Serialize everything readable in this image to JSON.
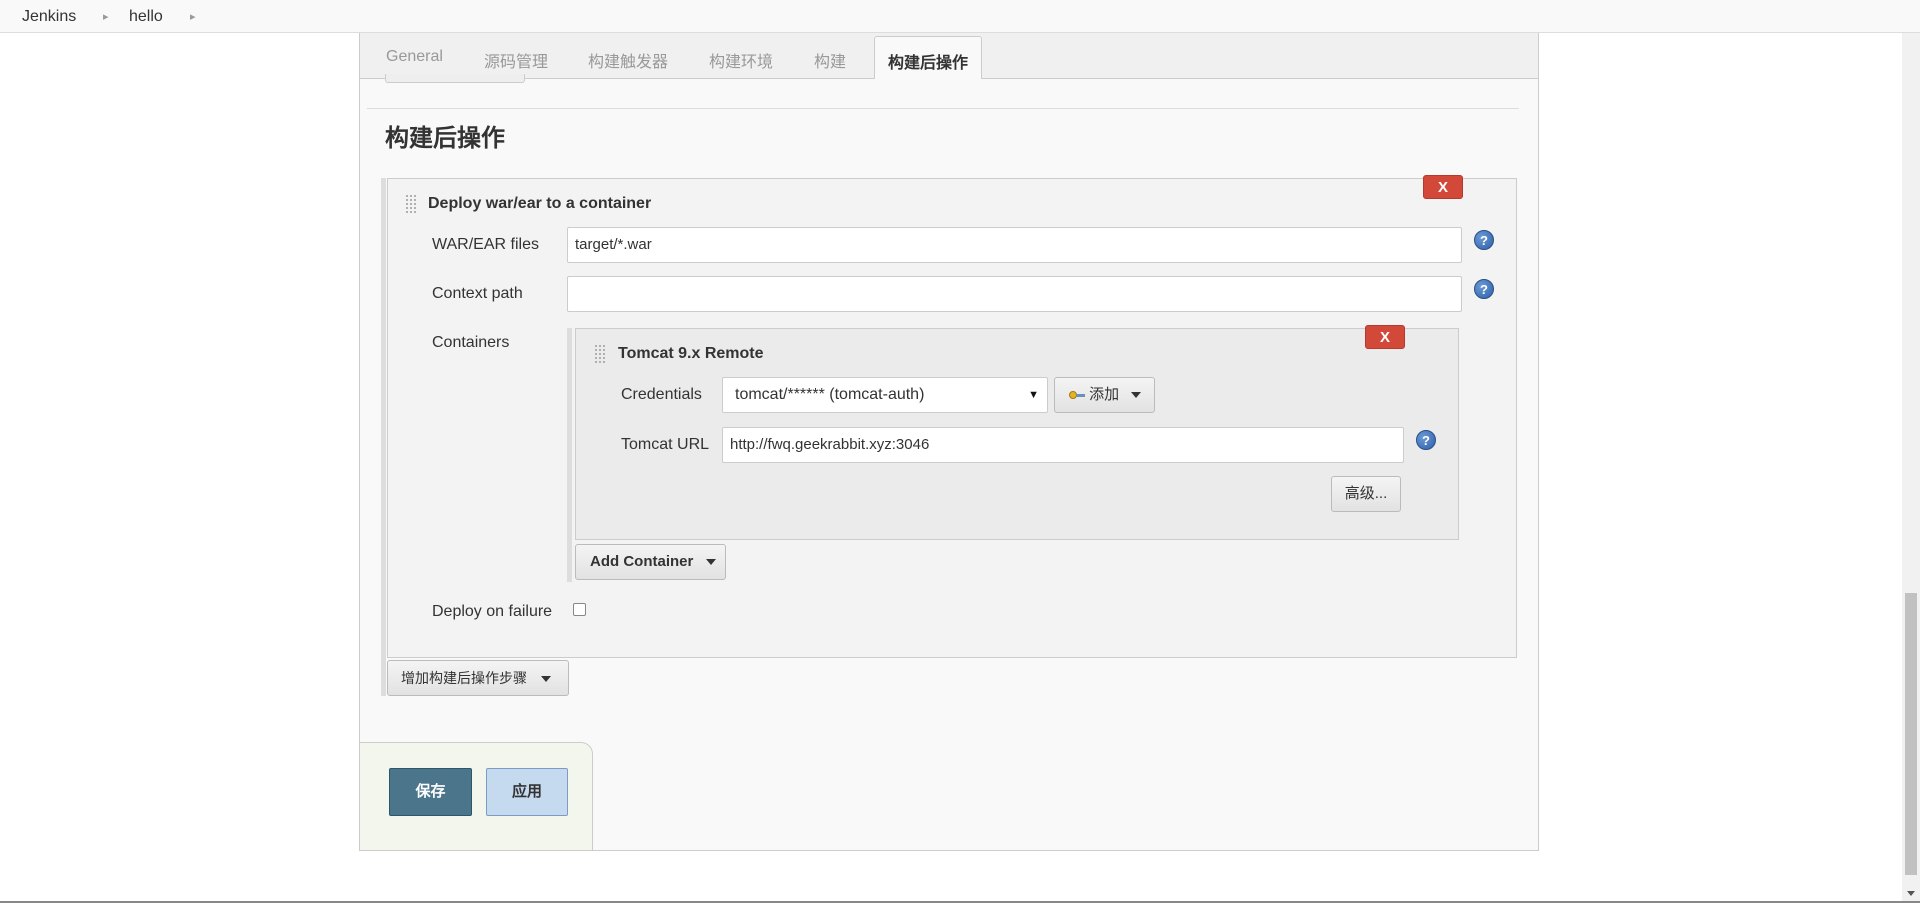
{
  "breadcrumb": {
    "items": [
      "Jenkins",
      "hello"
    ]
  },
  "tabs": [
    "General",
    "源码管理",
    "构建触发器",
    "构建环境",
    "构建",
    "构建后操作"
  ],
  "active_tab": "构建后操作",
  "section": {
    "title": "构建后操作"
  },
  "deploy": {
    "title": "Deploy war/ear to a container",
    "delete_label": "X",
    "war_label": "WAR/EAR files",
    "war_value": "target/*.war",
    "context_label": "Context path",
    "context_value": "",
    "containers_label": "Containers",
    "deploy_failure_label": "Deploy on failure",
    "deploy_failure_checked": false
  },
  "container": {
    "title": "Tomcat 9.x Remote",
    "delete_label": "X",
    "credentials_label": "Credentials",
    "credentials_value": "tomcat/****** (tomcat-auth)",
    "add_label": "添加",
    "url_label": "Tomcat URL",
    "url_value": "http://fwq.geekrabbit.xyz:3046",
    "advanced_label": "高级..."
  },
  "add_container_label": "Add Container",
  "add_step_label": "增加构建后操作步骤",
  "help_glyph": "?",
  "footer": {
    "save_label": "保存",
    "apply_label": "应用"
  },
  "colors": {
    "delete": "#d24939",
    "save": "#4b758b",
    "apply": "#c5d9ef",
    "help": "#2d5fa8"
  },
  "icons": {
    "breadcrumb_separator": "chevron-right-icon",
    "help": "help-icon",
    "drag": "drag-handle-icon",
    "credentials_add": "key-icon",
    "dropdown": "caret-down-icon"
  }
}
